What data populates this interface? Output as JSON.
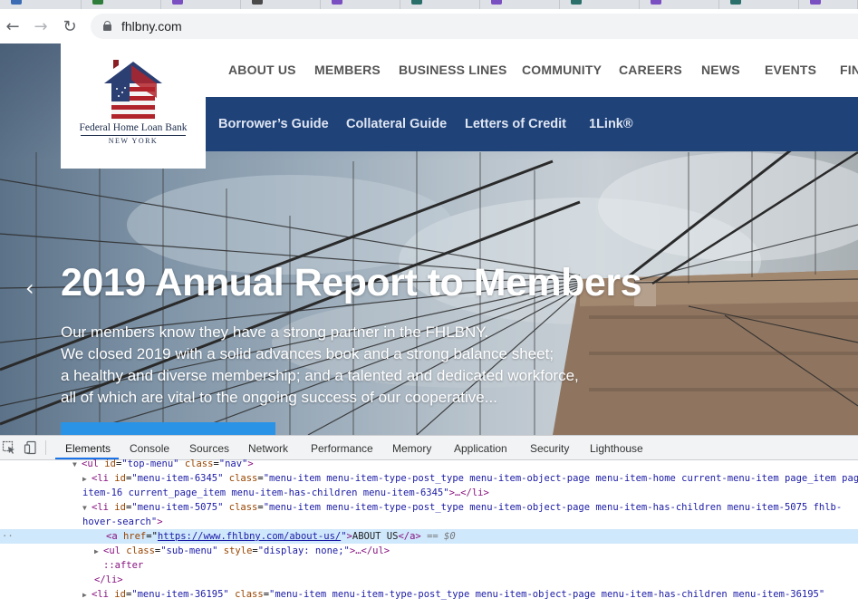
{
  "browser": {
    "url": "fhlbny.com"
  },
  "site": {
    "logo": {
      "name": "Federal Home Loan Bank",
      "location": "NEW YORK"
    },
    "top_menu": [
      "ABOUT US",
      "MEMBERS",
      "BUSINESS LINES",
      "COMMUNITY",
      "CAREERS",
      "NEWS",
      "EVENTS",
      "FIN"
    ],
    "sub_menu": [
      "Borrower’s Guide",
      "Collateral Guide",
      "Letters of Credit",
      "1Link®"
    ],
    "hero": {
      "headline": "2019 Annual Report to Members",
      "blurb": [
        "Our members know they have a strong partner in the FHLBNY.",
        "We closed 2019 with a solid advances book and a strong balance sheet;",
        "a healthy and diverse membership; and a talented and dedicated workforce,",
        "all of which are vital to the ongoing success of our cooperative..."
      ]
    }
  },
  "devtools": {
    "tabs": [
      "Elements",
      "Console",
      "Sources",
      "Network",
      "Performance",
      "Memory",
      "Application",
      "Security",
      "Lighthouse"
    ],
    "active_tab": "Elements",
    "dom": {
      "l1_tag": "<ul ",
      "l1_a1": "id",
      "l1_v1": "\"top-menu\"",
      "l1_a2": "class",
      "l1_v2": "\"nav\"",
      "l1_end": ">",
      "l2_tag": "<li ",
      "l2_a1": "id",
      "l2_v1": "\"menu-item-6345\"",
      "l2_a2": "class",
      "l2_v2": "\"menu-item menu-item-type-post_type menu-item-object-page menu-item-home current-menu-item page_item page-",
      "l3_v": "item-16 current_page_item menu-item-has-children menu-item-6345\"",
      "l3_end": ">…</li>",
      "l4_tag": "<li ",
      "l4_a1": "id",
      "l4_v1": "\"menu-item-5075\"",
      "l4_a2": "class",
      "l4_v2": "\"menu-item menu-item-type-post_type menu-item-object-page menu-item-has-children menu-item-5075 fhlb-",
      "l5_v": "hover-search\"",
      "l5_end": ">",
      "l6_tag": "<a ",
      "l6_a1": "href",
      "l6_link": "https://www.fhlbny.com/about-us/",
      "l6_text": "ABOUT US",
      "l6_close": "</a>",
      "l6_eq": "== $0",
      "l7_tag": "<ul ",
      "l7_a1": "class",
      "l7_v1": "\"sub-menu\"",
      "l7_a2": "style",
      "l7_v2": "\"display: none;\"",
      "l7_end": ">…</ul>",
      "l8": "::after",
      "l9": "</li>",
      "l10_tag": "<li ",
      "l10_a1": "id",
      "l10_v1": "\"menu-item-36195\"",
      "l10_a2": "class",
      "l10_v2": "\"menu-item menu-item-type-post_type menu-item-object-page menu-item-has-children menu-item-36195\""
    }
  },
  "colors": {
    "nav_blue": "#1f4279",
    "cta_blue": "#2a93e6",
    "devtools_selection": "#cfe8fc"
  }
}
